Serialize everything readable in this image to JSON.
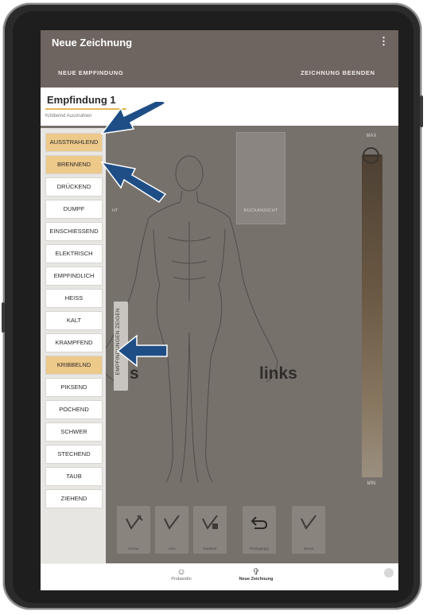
{
  "app": {
    "title": "Neue Zeichnung",
    "menu_icon": "more-vertical-icon",
    "menu_glyph": "⋮",
    "tab_new_sensation": "NEUE EMPFINDUNG",
    "tab_finish": "ZEICHNUNG BEENDEN"
  },
  "sensation": {
    "title": "Empfindung 1",
    "tags": "Kribbelnd  Ausstrahlen"
  },
  "canvas": {
    "back_view_label": "RÜCKANSICHT",
    "partial_label": "HT",
    "left_text": "links",
    "right_text_partial": "s",
    "slider_max": "MAX",
    "slider_min": "MIN",
    "slider_value": 1.0
  },
  "sensations_panel": {
    "toggle_label": "EMPFINDUNGEN ZEIGEN",
    "items": [
      {
        "label": "AUSSTRAHLEND",
        "selected": true
      },
      {
        "label": "BRENNEND",
        "selected": true
      },
      {
        "label": "DRÜCKEND",
        "selected": false
      },
      {
        "label": "DUMPF",
        "selected": false
      },
      {
        "label": "EINSCHIESSEND",
        "selected": false
      },
      {
        "label": "ELEKTRISCH",
        "selected": false
      },
      {
        "label": "EMPFINDLICH",
        "selected": false
      },
      {
        "label": "HEISS",
        "selected": false
      },
      {
        "label": "KALT",
        "selected": false
      },
      {
        "label": "KRAMPFEND",
        "selected": false
      },
      {
        "label": "KRIBBELND",
        "selected": true
      },
      {
        "label": "PIKSEND",
        "selected": false
      },
      {
        "label": "POCHEND",
        "selected": false
      },
      {
        "label": "SCHWER",
        "selected": false
      },
      {
        "label": "STECHEND",
        "selected": false
      },
      {
        "label": "TAUB",
        "selected": false
      },
      {
        "label": "ZIEHEND",
        "selected": false
      }
    ]
  },
  "toolbar": {
    "tools": [
      {
        "label": "Kontur",
        "icon": "brush-outline-icon"
      },
      {
        "label": "Linie",
        "icon": "brush-line-icon"
      },
      {
        "label": "Radierer",
        "icon": "eraser-icon"
      },
      {
        "label": "Rückgängig",
        "icon": "undo-icon"
      },
      {
        "label": "Bereit",
        "icon": "brush-ready-icon"
      }
    ]
  },
  "bottom_nav": {
    "items": [
      {
        "label": "ProbandIn",
        "icon": "person-circle-icon",
        "active": false
      },
      {
        "label": "Neue Zeichnung",
        "icon": "human-figure-icon",
        "active": true
      }
    ]
  },
  "colors": {
    "app_bar": "#6e6560",
    "selected_item": "#edc98a",
    "accent_underline": "#e7b659",
    "annotation_arrow": "#1f4e86"
  }
}
